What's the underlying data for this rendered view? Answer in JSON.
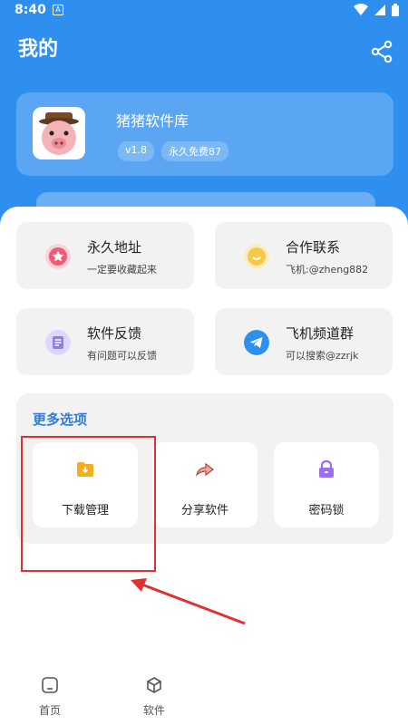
{
  "status_bar": {
    "time": "8:40",
    "notification_letter": "A"
  },
  "header": {
    "title": "我的",
    "share_icon": "share-icon"
  },
  "profile": {
    "app_name": "猪猪软件库",
    "version": "v1.8",
    "tag": "永久免费87",
    "avatar_icon": "pig-avatar-icon"
  },
  "tiles": [
    {
      "title": "永久地址",
      "subtitle": "一定要收藏起来",
      "icon": "star-icon",
      "color": "#ee5a7a"
    },
    {
      "title": "合作联系",
      "subtitle": "飞机:@zheng882",
      "icon": "smile-icon",
      "color": "#f3c94b"
    },
    {
      "title": "软件反馈",
      "subtitle": "有问题可以反馈",
      "icon": "feedback-icon",
      "color": "#8a7ef0"
    },
    {
      "title": "飞机频道群",
      "subtitle": "可以搜索@zzrjk",
      "icon": "telegram-icon",
      "color": "#2f8fee"
    }
  ],
  "more_options": {
    "title": "更多选项",
    "items": [
      {
        "label": "下载管理",
        "icon": "download-folder-icon",
        "color": "#f2b01e"
      },
      {
        "label": "分享软件",
        "icon": "share-arrow-icon",
        "color": "#e07a6a"
      },
      {
        "label": "密码锁",
        "icon": "lock-icon",
        "color": "#9b6ff0"
      }
    ]
  },
  "bottom_nav": [
    {
      "label": "首页",
      "icon": "home-icon"
    },
    {
      "label": "软件",
      "icon": "box-icon"
    }
  ]
}
